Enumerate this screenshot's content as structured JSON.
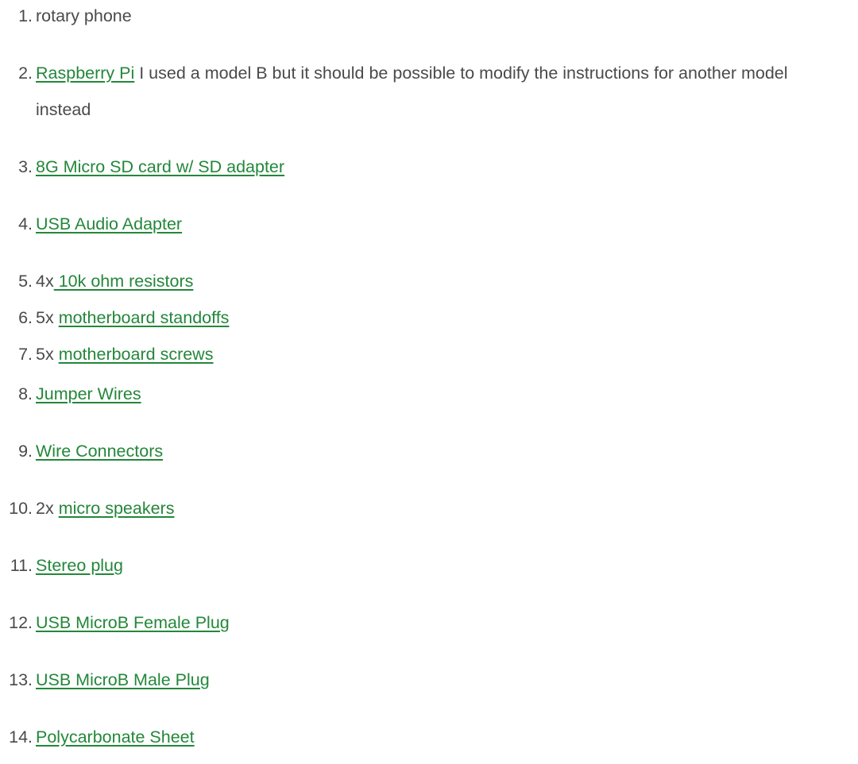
{
  "link_color": "#23873a",
  "text_color": "#4a4a4a",
  "items": [
    {
      "number": "1.",
      "prefix": "rotary phone",
      "link": "",
      "suffix": ""
    },
    {
      "number": "2.",
      "prefix": "",
      "link": "Raspberry Pi",
      "suffix": " I used a model B but it should be possible to modify the instructions for another model instead"
    },
    {
      "number": "3.",
      "prefix": "",
      "link": "8G Micro SD card w/ SD adapter",
      "suffix": ""
    },
    {
      "number": "4.",
      "prefix": "",
      "link": "USB Audio Adapter",
      "suffix": ""
    },
    {
      "number": "5.",
      "prefix": "4x",
      "link": " 10k ohm resistors",
      "suffix": ""
    },
    {
      "number": "6.",
      "prefix": "5x ",
      "link": "motherboard standoffs",
      "suffix": ""
    },
    {
      "number": "7.",
      "prefix": "5x ",
      "link": "motherboard screws",
      "suffix": ""
    },
    {
      "number": "8.",
      "prefix": "",
      "link": "Jumper Wires",
      "suffix": ""
    },
    {
      "number": "9.",
      "prefix": "",
      "link": "Wire Connectors",
      "suffix": ""
    },
    {
      "number": "10.",
      "prefix": "2x ",
      "link": "micro speakers",
      "suffix": ""
    },
    {
      "number": "11.",
      "prefix": "",
      "link": "Stereo plug",
      "suffix": ""
    },
    {
      "number": "12.",
      "prefix": "",
      "link": "USB MicroB Female Plug",
      "suffix": ""
    },
    {
      "number": "13.",
      "prefix": "",
      "link": "USB MicroB Male Plug",
      "suffix": ""
    },
    {
      "number": "14.",
      "prefix": "",
      "link": "Polycarbonate Sheet",
      "suffix": ""
    }
  ]
}
